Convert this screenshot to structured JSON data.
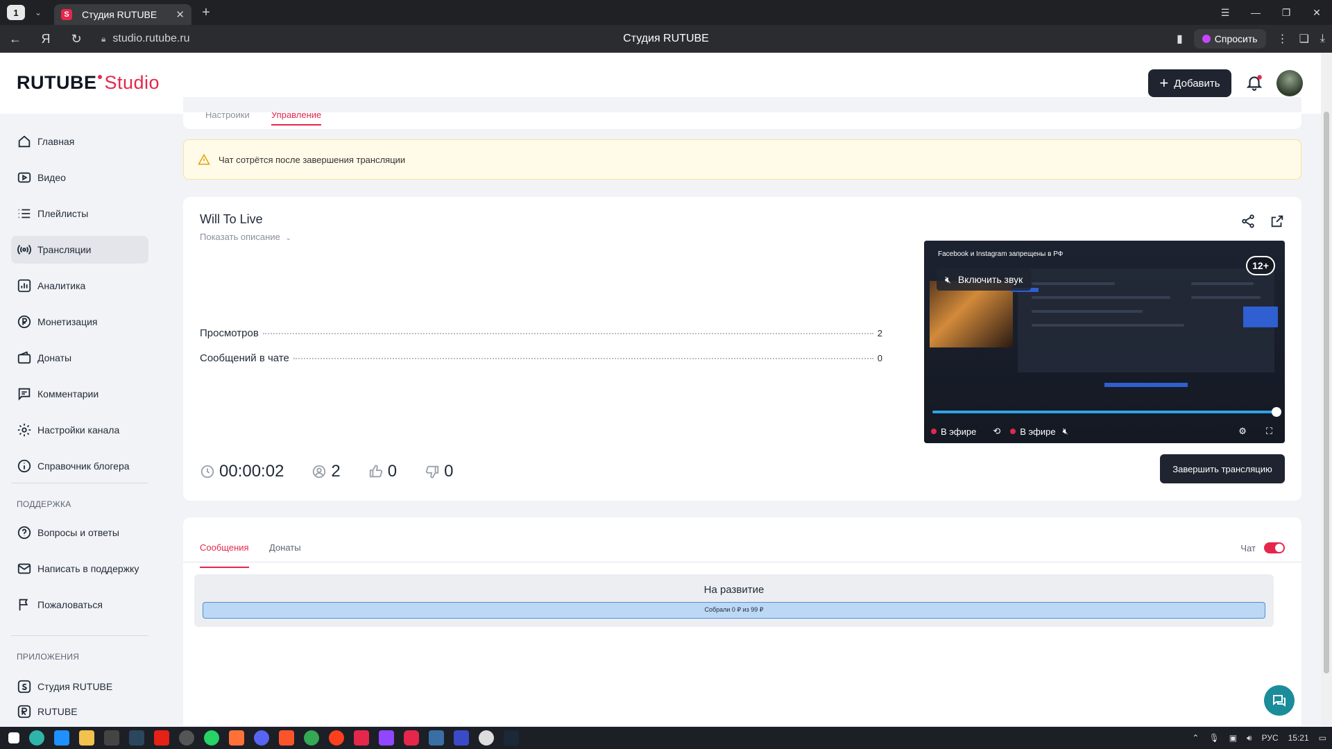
{
  "browser": {
    "tab_count": "1",
    "tab_title": "Студия RUTUBE",
    "url": "studio.rutube.ru",
    "page_title": "Студия RUTUBE",
    "ask_label": "Спросить"
  },
  "header": {
    "logo_main": "RUTUBE",
    "logo_studio": "Studio",
    "add_label": "Добавить"
  },
  "sidebar": {
    "items": [
      {
        "label": "Главная"
      },
      {
        "label": "Видео"
      },
      {
        "label": "Плейлисты"
      },
      {
        "label": "Трансляции"
      },
      {
        "label": "Аналитика"
      },
      {
        "label": "Монетизация"
      },
      {
        "label": "Донаты"
      },
      {
        "label": "Комментарии"
      },
      {
        "label": "Настройки канала"
      },
      {
        "label": "Справочник блогера"
      }
    ],
    "support_heading": "ПОДДЕРЖКА",
    "support_items": [
      {
        "label": "Вопросы и ответы"
      },
      {
        "label": "Написать в поддержку"
      },
      {
        "label": "Пожаловаться"
      }
    ],
    "apps_heading": "ПРИЛОЖЕНИЯ",
    "apps_items": [
      {
        "label": "Студия RUTUBE"
      },
      {
        "label": "RUTUBE"
      }
    ]
  },
  "subtabs": {
    "settings": "Настройки",
    "manage": "Управление"
  },
  "warning": {
    "text": "Чат сотрётся после завершения трансляции"
  },
  "stream": {
    "title": "Will To Live",
    "show_description": "Показать описание",
    "views_label": "Просмотров",
    "views_value": "2",
    "messages_label": "Сообщений в чате",
    "messages_value": "0",
    "duration": "00:00:02",
    "viewers": "2",
    "likes": "0",
    "dislikes": "0",
    "end_button": "Завершить трансляцию"
  },
  "player": {
    "news_ticker": "Facebook и Instagram запрещены в РФ",
    "unmute_label": "Включить звук",
    "age_rating": "12+",
    "live_overlay": "В эфире",
    "live_label": "В эфире",
    "progress": 1.0
  },
  "chat": {
    "tab_messages": "Сообщения",
    "tab_donations": "Донаты",
    "chat_toggle_label": "Чат",
    "chat_enabled": true,
    "goal_title": "На развитие",
    "goal_progress_text": "Собрали 0 ₽ из 99 ₽",
    "goal_fraction": 0.0
  },
  "taskbar": {
    "language": "РУС",
    "time": "15:21"
  }
}
